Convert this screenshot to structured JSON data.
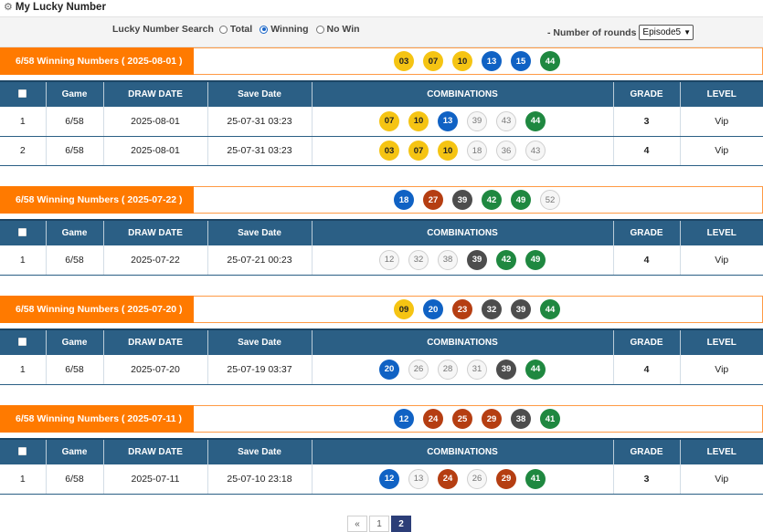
{
  "header": {
    "title": "My Lucky Number",
    "icon": "gear-icon"
  },
  "search": {
    "label": "Lucky Number Search",
    "options": [
      {
        "label": "Total",
        "selected": false
      },
      {
        "label": "Winning",
        "selected": true
      },
      {
        "label": "No Win",
        "selected": false
      }
    ],
    "rounds_label": "- Number of rounds",
    "rounds_value": "Episode5"
  },
  "columns": [
    "Game",
    "DRAW DATE",
    "Save Date",
    "COMBINATIONS",
    "GRADE",
    "LEVEL"
  ],
  "ball_colors": {
    "yellow": "#f5c413",
    "blue": "#1062c4",
    "red": "#b53e12",
    "dark": "#4d4d4d",
    "green": "#1f8840",
    "white": "#f6f6f6"
  },
  "draws": [
    {
      "label": "6/58 Winning Numbers ( 2025-08-01 )",
      "numbers": [
        {
          "n": "03",
          "c": "yellow"
        },
        {
          "n": "07",
          "c": "yellow"
        },
        {
          "n": "10",
          "c": "yellow"
        },
        {
          "n": "13",
          "c": "blue"
        },
        {
          "n": "15",
          "c": "blue"
        },
        {
          "n": "44",
          "c": "green"
        }
      ],
      "rows": [
        {
          "no": "1",
          "game": "6/58",
          "draw_date": "2025-08-01",
          "save_date": "25-07-31 03:23",
          "combo": [
            {
              "n": "07",
              "c": "yellow"
            },
            {
              "n": "10",
              "c": "yellow"
            },
            {
              "n": "13",
              "c": "blue"
            },
            {
              "n": "39",
              "c": "white"
            },
            {
              "n": "43",
              "c": "white"
            },
            {
              "n": "44",
              "c": "green"
            }
          ],
          "grade": "3",
          "level": "Vip"
        },
        {
          "no": "2",
          "game": "6/58",
          "draw_date": "2025-08-01",
          "save_date": "25-07-31 03:23",
          "combo": [
            {
              "n": "03",
              "c": "yellow"
            },
            {
              "n": "07",
              "c": "yellow"
            },
            {
              "n": "10",
              "c": "yellow"
            },
            {
              "n": "18",
              "c": "white"
            },
            {
              "n": "36",
              "c": "white"
            },
            {
              "n": "43",
              "c": "white"
            }
          ],
          "grade": "4",
          "level": "Vip"
        }
      ]
    },
    {
      "label": "6/58 Winning Numbers ( 2025-07-22 )",
      "numbers": [
        {
          "n": "18",
          "c": "blue"
        },
        {
          "n": "27",
          "c": "red"
        },
        {
          "n": "39",
          "c": "dark"
        },
        {
          "n": "42",
          "c": "green"
        },
        {
          "n": "49",
          "c": "green"
        },
        {
          "n": "52",
          "c": "white"
        }
      ],
      "rows": [
        {
          "no": "1",
          "game": "6/58",
          "draw_date": "2025-07-22",
          "save_date": "25-07-21 00:23",
          "combo": [
            {
              "n": "12",
              "c": "white"
            },
            {
              "n": "32",
              "c": "white"
            },
            {
              "n": "38",
              "c": "white"
            },
            {
              "n": "39",
              "c": "dark"
            },
            {
              "n": "42",
              "c": "green"
            },
            {
              "n": "49",
              "c": "green"
            }
          ],
          "grade": "4",
          "level": "Vip"
        }
      ]
    },
    {
      "label": "6/58 Winning Numbers ( 2025-07-20 )",
      "numbers": [
        {
          "n": "09",
          "c": "yellow"
        },
        {
          "n": "20",
          "c": "blue"
        },
        {
          "n": "23",
          "c": "red"
        },
        {
          "n": "32",
          "c": "dark"
        },
        {
          "n": "39",
          "c": "dark"
        },
        {
          "n": "44",
          "c": "green"
        }
      ],
      "rows": [
        {
          "no": "1",
          "game": "6/58",
          "draw_date": "2025-07-20",
          "save_date": "25-07-19 03:37",
          "combo": [
            {
              "n": "20",
              "c": "blue"
            },
            {
              "n": "26",
              "c": "white"
            },
            {
              "n": "28",
              "c": "white"
            },
            {
              "n": "31",
              "c": "white"
            },
            {
              "n": "39",
              "c": "dark"
            },
            {
              "n": "44",
              "c": "green"
            }
          ],
          "grade": "4",
          "level": "Vip"
        }
      ]
    },
    {
      "label": "6/58 Winning Numbers ( 2025-07-11 )",
      "numbers": [
        {
          "n": "12",
          "c": "blue"
        },
        {
          "n": "24",
          "c": "red"
        },
        {
          "n": "25",
          "c": "red"
        },
        {
          "n": "29",
          "c": "red"
        },
        {
          "n": "38",
          "c": "dark"
        },
        {
          "n": "41",
          "c": "green"
        }
      ],
      "rows": [
        {
          "no": "1",
          "game": "6/58",
          "draw_date": "2025-07-11",
          "save_date": "25-07-10 23:18",
          "combo": [
            {
              "n": "12",
              "c": "blue"
            },
            {
              "n": "13",
              "c": "white"
            },
            {
              "n": "24",
              "c": "red"
            },
            {
              "n": "26",
              "c": "white"
            },
            {
              "n": "29",
              "c": "red"
            },
            {
              "n": "41",
              "c": "green"
            }
          ],
          "grade": "3",
          "level": "Vip"
        }
      ]
    }
  ],
  "pagination": {
    "first": "«",
    "pages": [
      "1",
      "2"
    ],
    "active": "2"
  }
}
